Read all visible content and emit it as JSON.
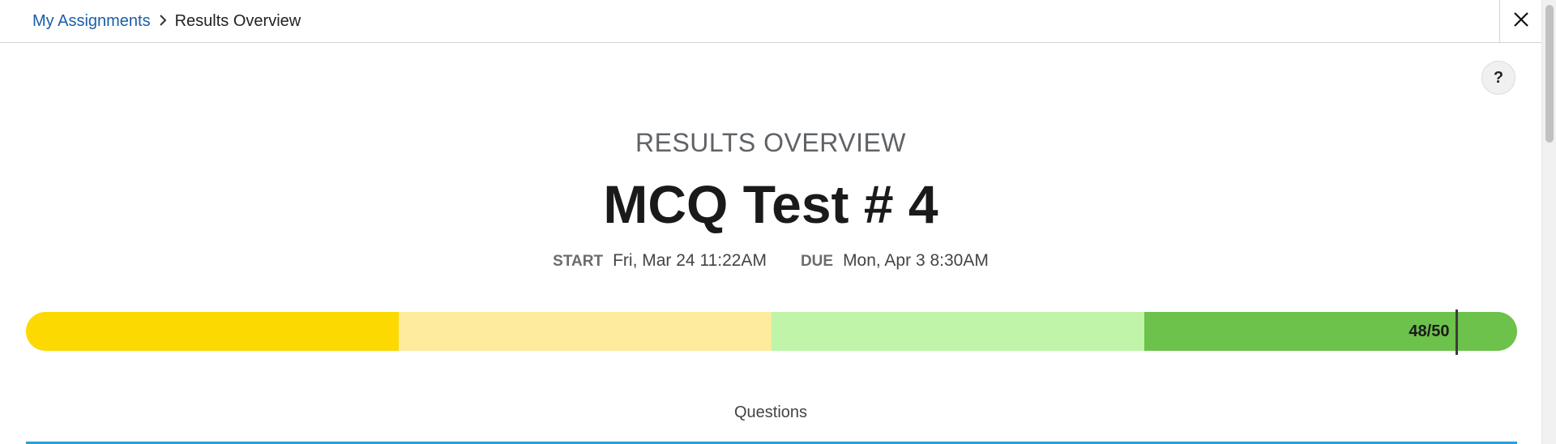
{
  "breadcrumb": {
    "parent_label": "My Assignments",
    "separator": "›",
    "current_label": "Results Overview"
  },
  "icons": {
    "close": "close-icon",
    "help": "help-icon",
    "chevron": "chevron-right-icon"
  },
  "help": {
    "label": "?"
  },
  "header": {
    "overline": "RESULTS OVERVIEW",
    "title": "MCQ Test # 4"
  },
  "dates": {
    "start_label": "START",
    "start_value": "Fri, Mar 24 11:22AM",
    "due_label": "DUE",
    "due_value": "Mon, Apr 3 8:30AM"
  },
  "score": {
    "text": "48/50",
    "value": 48,
    "max": 50,
    "fraction": 0.96
  },
  "colors": {
    "link": "#1a5ea8",
    "band_1": "#fcd900",
    "band_2": "#feeb9d",
    "band_3": "#c0f4a8",
    "band_4": "#6cc24a",
    "section_rule": "#2a9fd6"
  },
  "sections": {
    "questions_label": "Questions"
  }
}
